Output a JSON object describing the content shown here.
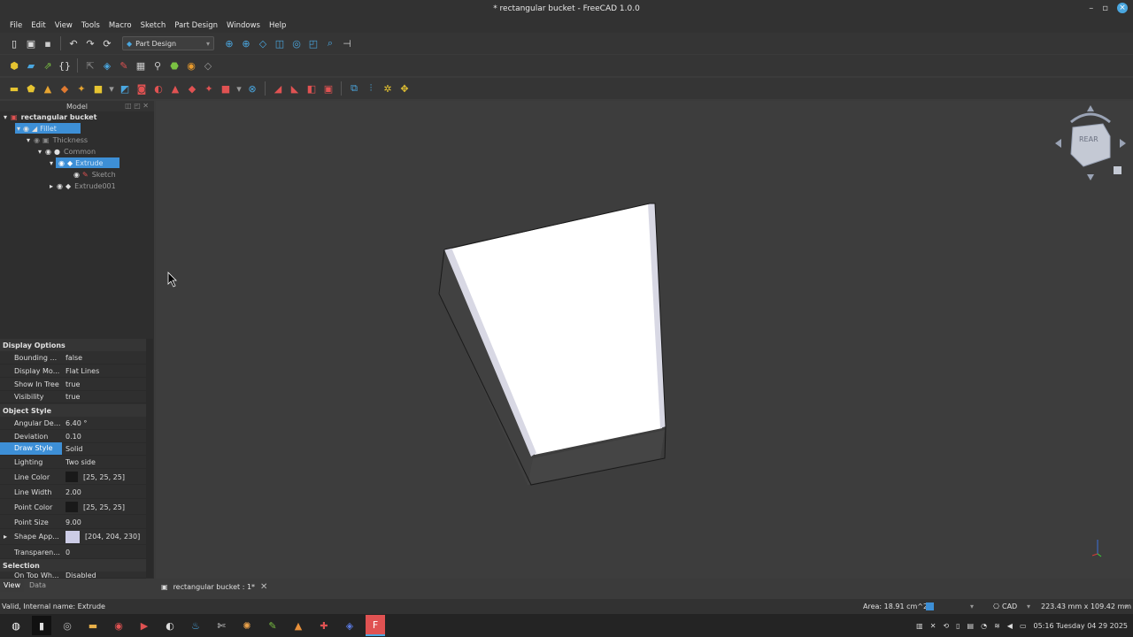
{
  "window": {
    "title": "* rectangular bucket - FreeCAD 1.0.0"
  },
  "menu": [
    "File",
    "Edit",
    "View",
    "Tools",
    "Macro",
    "Sketch",
    "Part Design",
    "Windows",
    "Help"
  ],
  "toolbar": {
    "workbench": "Part Design"
  },
  "model_panel": {
    "title": "Model",
    "tree": [
      {
        "label": "rectangular bucket",
        "depth": 0,
        "selected": false
      },
      {
        "label": "Fillet",
        "depth": 1,
        "selected": true
      },
      {
        "label": "Thickness",
        "depth": 2,
        "selected": false
      },
      {
        "label": "Common",
        "depth": 3,
        "selected": false
      },
      {
        "label": "Extrude",
        "depth": 4,
        "selected": true
      },
      {
        "label": "Sketch",
        "depth": 5,
        "selected": false
      },
      {
        "label": "Extrude001",
        "depth": 4,
        "selected": false
      }
    ]
  },
  "properties": {
    "groups": [
      {
        "name": "Display Options",
        "rows": [
          {
            "key": "Bounding ...",
            "value": "false"
          },
          {
            "key": "Display Mo...",
            "value": "Flat Lines"
          },
          {
            "key": "Show In Tree",
            "value": "true"
          },
          {
            "key": "Visibility",
            "value": "true"
          }
        ]
      },
      {
        "name": "Object Style",
        "rows": [
          {
            "key": "Angular De...",
            "value": "6.40 °"
          },
          {
            "key": "Deviation",
            "value": "0.10"
          },
          {
            "key": "Draw Style",
            "value": "Solid",
            "highlight": true
          },
          {
            "key": "Lighting",
            "value": "Two side"
          },
          {
            "key": "Line Color",
            "value": "[25, 25, 25]",
            "swatch": "#191919"
          },
          {
            "key": "Line Width",
            "value": "2.00"
          },
          {
            "key": "Point Color",
            "value": "[25, 25, 25]",
            "swatch": "#191919"
          },
          {
            "key": "Point Size",
            "value": "9.00"
          },
          {
            "key": "Shape App...",
            "value": "[204, 204, 230]",
            "swatch": "#ccccE6"
          },
          {
            "key": "Transparen...",
            "value": "0"
          }
        ]
      },
      {
        "name": "Selection",
        "rows": [
          {
            "key": "On Top Wh...",
            "value": "Disabled"
          }
        ]
      }
    ]
  },
  "bottom_tabs": [
    "View",
    "Data"
  ],
  "doc_tab": "rectangular bucket : 1*",
  "navcube": {
    "face": "REAR"
  },
  "status": {
    "message": "Valid, Internal name: Extrude",
    "area": "Area: 18.91 cm^2",
    "nav_style": "CAD",
    "dimensions": "223.43 mm x 109.42 mm"
  },
  "clock": "05:16 Tuesday 04 29 2025",
  "colors": {
    "accent": "#3d8fd6",
    "face": "#ffffff",
    "side": "#414141",
    "background": "#3d3d3d"
  }
}
